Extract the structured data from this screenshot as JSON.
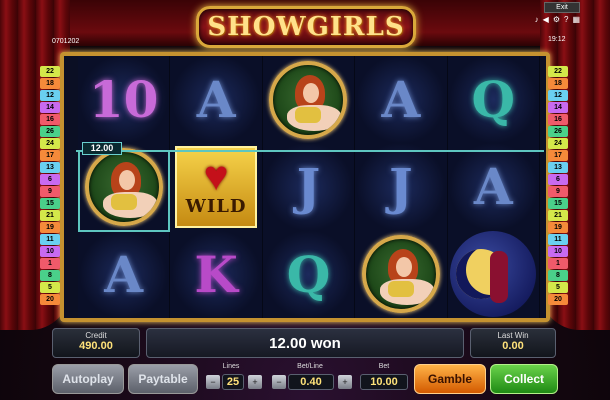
{
  "game": {
    "title": "SHOWGIRLS"
  },
  "top_bar": {
    "left_code": "0701202",
    "time": "19:12",
    "exit_label": "Exit",
    "icons": [
      "music-note-icon",
      "sound-icon",
      "settings-icon",
      "help-icon",
      "menu-icon"
    ]
  },
  "paylines_left": [
    "22",
    "18",
    "12",
    "14",
    "16",
    "26",
    "24",
    "17",
    "13",
    "6",
    "9",
    "15",
    "21",
    "19",
    "11",
    "10",
    "1",
    "8",
    "5",
    "20"
  ],
  "paylines_right": [
    "22",
    "18",
    "12",
    "14",
    "16",
    "26",
    "24",
    "17",
    "13",
    "6",
    "9",
    "15",
    "21",
    "19",
    "11",
    "10",
    "1",
    "8",
    "5",
    "20"
  ],
  "reels": [
    [
      "10",
      "A",
      "showgirl",
      "A",
      "Q"
    ],
    [
      "showgirl",
      "WILD",
      "J",
      "J",
      "A"
    ],
    [
      "A",
      "K",
      "Q",
      "showgirl",
      "moon"
    ]
  ],
  "win_badge": "12.00",
  "wild_label": "WILD",
  "credit": {
    "label": "Credit",
    "value": "490.00"
  },
  "won_text": "12.00 won",
  "last_win": {
    "label": "Last Win",
    "value": "0.00"
  },
  "buttons": {
    "autoplay": "Autoplay",
    "paytable": "Paytable",
    "gamble": "Gamble",
    "collect": "Collect"
  },
  "lines": {
    "label": "Lines",
    "value": "25"
  },
  "bet_line": {
    "label": "Bet/Line",
    "value": "0.40"
  },
  "bet": {
    "label": "Bet",
    "value": "10.00"
  },
  "colors": {
    "gold": "#d6a84a",
    "reel_bg": "#0b0f24",
    "win_line": "#5ec6c0",
    "gamble": "#d35a00",
    "collect": "#1f8a14"
  }
}
